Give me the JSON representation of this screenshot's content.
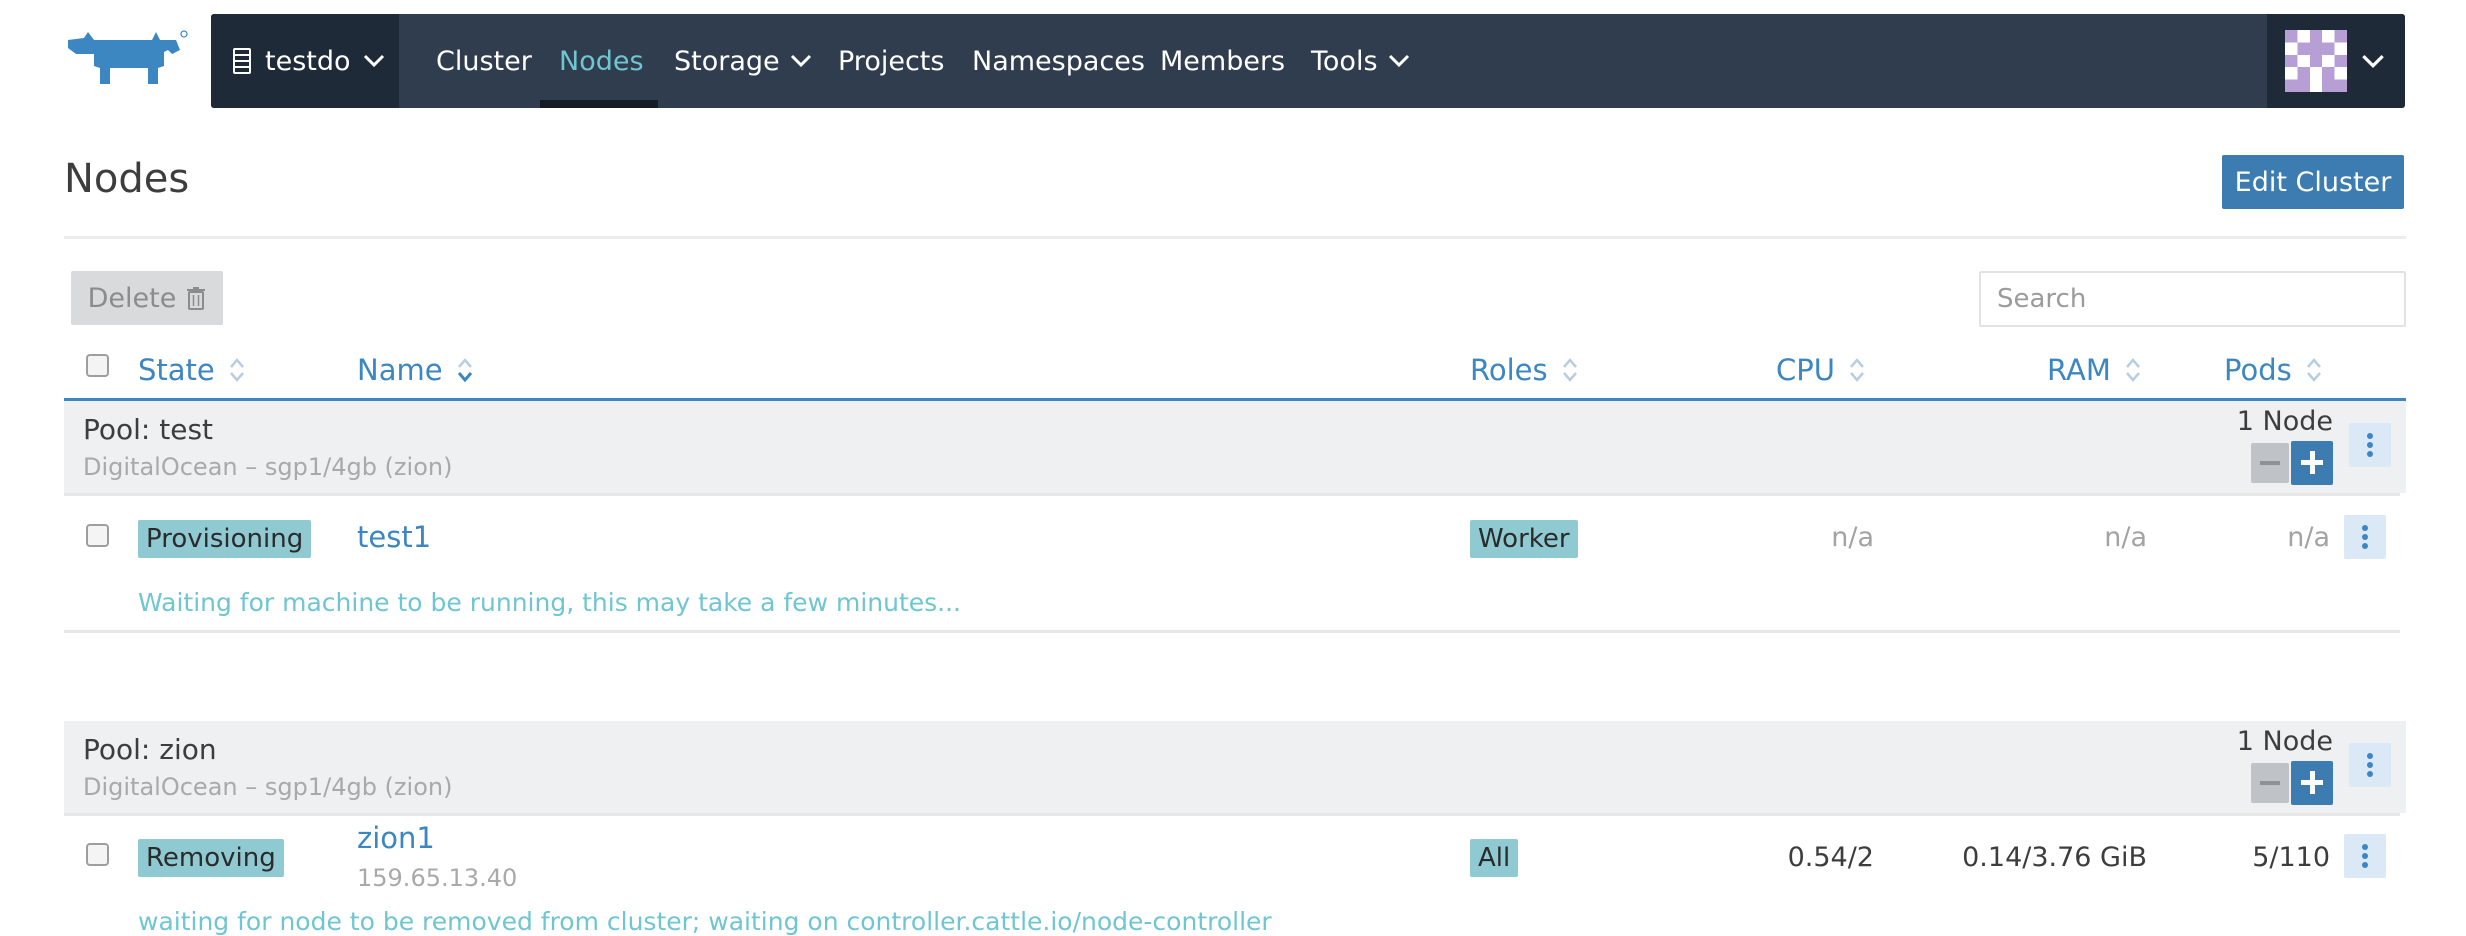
{
  "header": {
    "cluster_name": "testdo",
    "nav": [
      {
        "label": "Cluster"
      },
      {
        "label": "Nodes"
      },
      {
        "label": "Storage"
      },
      {
        "label": "Projects"
      },
      {
        "label": "Namespaces"
      },
      {
        "label": "Members"
      },
      {
        "label": "Tools"
      }
    ],
    "active": "Nodes"
  },
  "page": {
    "title": "Nodes",
    "edit_label": "Edit Cluster"
  },
  "toolbar": {
    "delete_label": "Delete",
    "search_placeholder": "Search"
  },
  "table": {
    "columns": [
      {
        "label": "State"
      },
      {
        "label": "Name"
      },
      {
        "label": "Roles"
      },
      {
        "label": "CPU"
      },
      {
        "label": "RAM"
      },
      {
        "label": "Pods"
      }
    ],
    "sort_column": "Name"
  },
  "pools": [
    {
      "name": "Pool: test",
      "description": "DigitalOcean – sgp1/4gb (zion)",
      "count_label": "1 Node",
      "node": {
        "state": "Provisioning",
        "name": "test1",
        "ip": "",
        "roles": "Worker",
        "cpu": "n/a",
        "ram": "n/a",
        "pods": "n/a",
        "message": "Waiting for machine to be running, this may take a few minutes..."
      }
    },
    {
      "name": "Pool: zion",
      "description": "DigitalOcean – sgp1/4gb (zion)",
      "count_label": "1 Node",
      "node": {
        "state": "Removing",
        "name": "zion1",
        "ip": "159.65.13.40",
        "roles": "All",
        "cpu": "0.54/2",
        "ram": "0.14/3.76 GiB",
        "pods": "5/110",
        "message": "waiting for node to be removed from cluster; waiting on controller.cattle.io/node-controller"
      }
    }
  ],
  "colors": {
    "topbar": "#2f3d4f",
    "accent": "#3c86c2",
    "active_nav": "#6fc6d1",
    "badge": "#8fcad2",
    "primary_button": "#3c7cb0"
  },
  "icons": {
    "logo": "rancher-cow-logo",
    "cluster": "server-icon",
    "sort": "sort-icon",
    "delete": "trash-icon",
    "row_menu": "kebab-menu-icon"
  }
}
